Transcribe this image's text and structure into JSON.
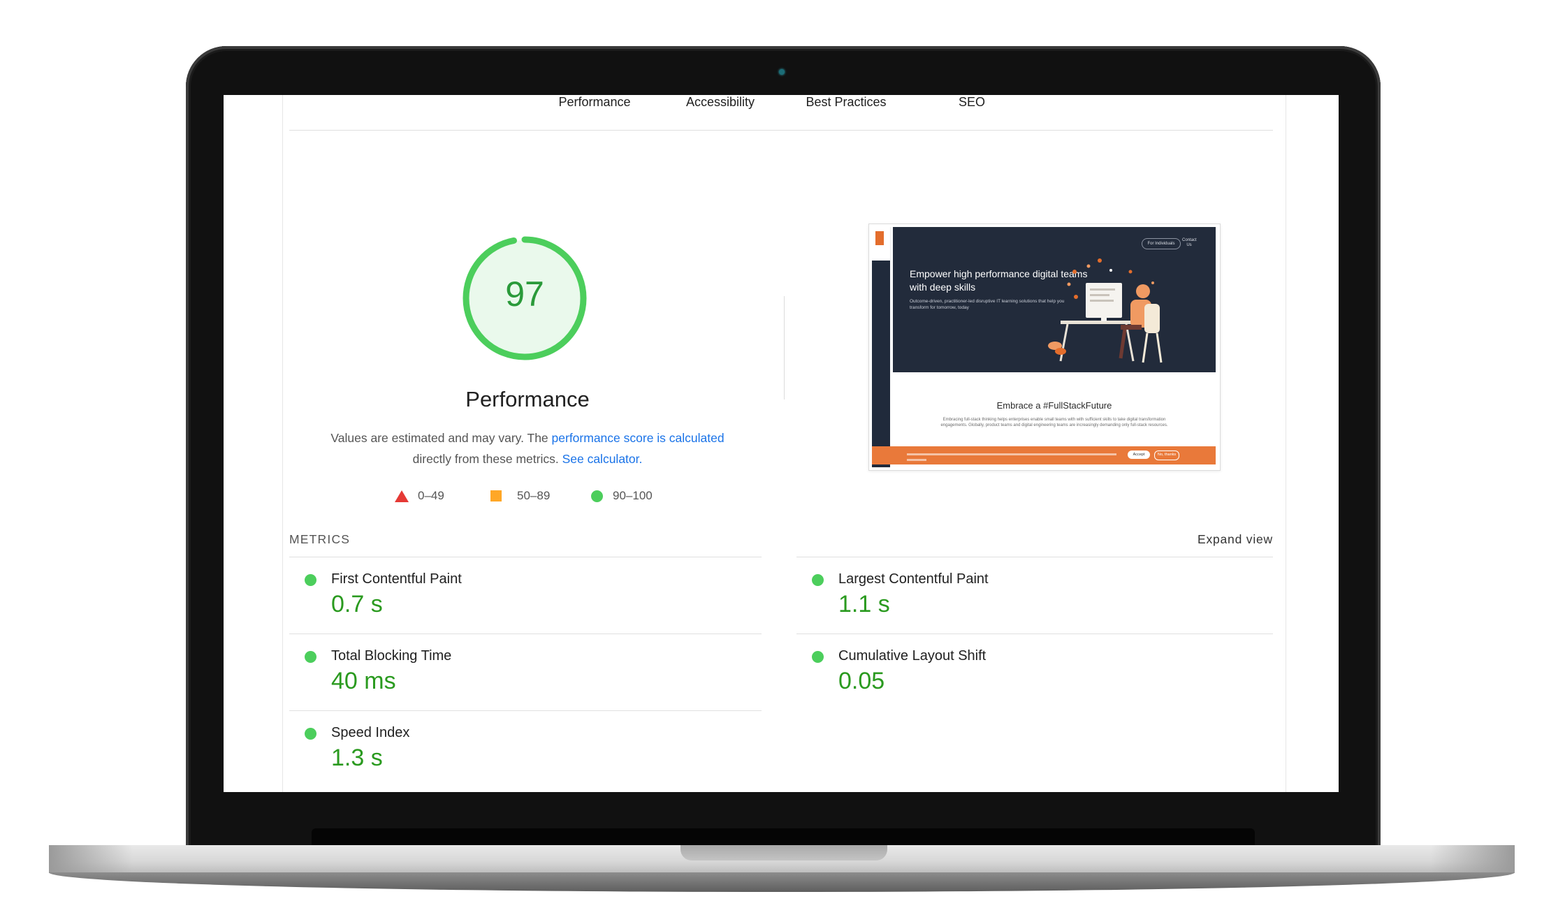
{
  "tabs": [
    "Performance",
    "Accessibility",
    "Best Practices",
    "SEO"
  ],
  "gauge": {
    "score": "97",
    "score_fraction": 0.97,
    "title": "Performance",
    "desc_prefix": "Values are estimated and may vary. The ",
    "desc_link1": "performance score is calculated",
    "desc_middle": " directly from these metrics. ",
    "desc_link2": "See calculator.",
    "color": "#4cce5c"
  },
  "legend": [
    {
      "icon": "red-triangle-icon",
      "range": "0–49"
    },
    {
      "icon": "orange-square-icon",
      "range": "50–89"
    },
    {
      "icon": "green-circle-icon",
      "range": "90–100"
    }
  ],
  "thumbnail": {
    "hero_title": "Empower high performance digital teams with deep skills",
    "hero_sub": "Outcome-driven, practitioner-led disruptive IT learning solutions that help you transform for tomorrow, today",
    "pill": "For Individuals",
    "contact": "Contact Us",
    "section_title": "Embrace a #FullStackFuture",
    "section_sub": "Embracing full-stack thinking helps enterprises enable small teams with with sufficient skills to take digital transformation engagements. Globally, product teams and digital engineering teams are increasingly demanding only full-stack resources.",
    "accept": "Accept",
    "no_thanks": "No, thanks"
  },
  "metrics_header": "METRICS",
  "expand_view": "Expand view",
  "metrics": [
    {
      "name": "First Contentful Paint",
      "value": "0.7 s",
      "status": "good"
    },
    {
      "name": "Largest Contentful Paint",
      "value": "1.1 s",
      "status": "good"
    },
    {
      "name": "Total Blocking Time",
      "value": "40 ms",
      "status": "good"
    },
    {
      "name": "Cumulative Layout Shift",
      "value": "0.05",
      "status": "good"
    },
    {
      "name": "Speed Index",
      "value": "1.3 s",
      "status": "good"
    }
  ]
}
